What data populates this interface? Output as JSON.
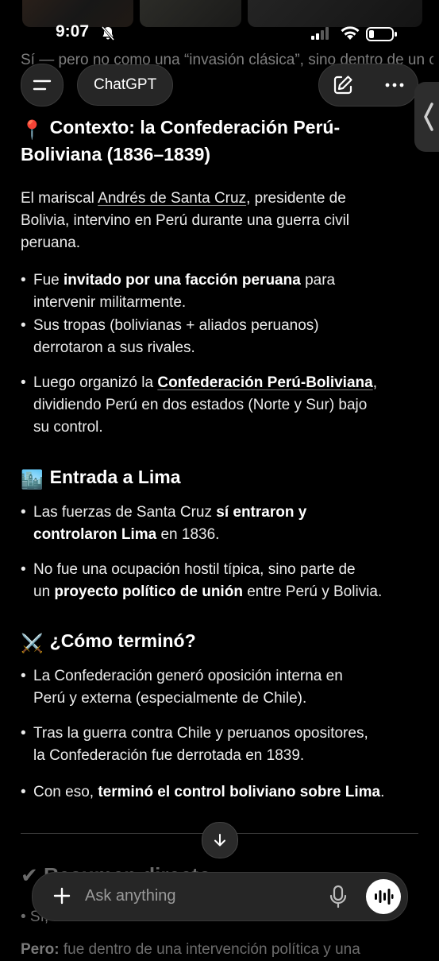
{
  "status": {
    "time": "9:07"
  },
  "ghost_text": "Sí — pero no como una “invasión clásica”, sino dentro de un contexto político particular.",
  "header": {
    "title": "ChatGPT"
  },
  "section1": {
    "emoji": "📍",
    "heading_line1": "Contexto: la Confederación Perú-",
    "heading_line2": "Boliviana (1836–1839)",
    "para": {
      "l1_pre": "El mariscal ",
      "l1_link": "Andrés de Santa Cruz",
      "l1_post": ", presidente de",
      "l2": "Bolivia, intervino en Perú durante una guerra civil",
      "l3": "peruana."
    },
    "bullet1": {
      "pre": "Fue ",
      "bold": "invitado por una facción peruana",
      "post": " para",
      "l2": "intervenir militarmente."
    },
    "bullet2": {
      "l1": "Sus tropas (bolivianas + aliados peruanos)",
      "l2": "derrotaron a sus rivales."
    },
    "bullet3": {
      "pre": "Luego organizó la ",
      "link": "Confederación Perú-Boliviana",
      "post": ",",
      "l2": "dividiendo Perú en dos estados (Norte y Sur) bajo",
      "l3": "su control."
    }
  },
  "section2": {
    "emoji": "🏙️",
    "heading": "Entrada a Lima",
    "bullet1": {
      "pre": "Las fuerzas de Santa Cruz ",
      "bold1": "sí entraron y",
      "bold2": "controlaron Lima",
      "post": " en 1836."
    },
    "bullet2": {
      "l1": "No fue una ocupación hostil típica, sino parte de",
      "pre": "un ",
      "bold": "proyecto político de unión",
      "post": " entre Perú y Bolivia."
    }
  },
  "section3": {
    "emoji": "⚔️",
    "heading": "¿Cómo terminó?",
    "bullet1": {
      "l1": "La Confederación generó oposición interna en",
      "l2": "Perú y externa (especialmente de Chile)."
    },
    "bullet2": {
      "l1": "Tras la guerra contra Chile y peruanos opositores,",
      "l2": "la Confederación fue derrotada en 1839."
    },
    "bullet3": {
      "pre": "Con eso, ",
      "bold": "terminó el control boliviano sobre Lima",
      "post": "."
    }
  },
  "under_composer": {
    "heading": "✔ Resumen directo",
    "line1": "• Sí, ...",
    "line2_bold": "Pero:",
    "line2_rest": " fue dentro de una intervención política y una"
  },
  "composer": {
    "placeholder": "Ask anything"
  },
  "icons": {
    "menu": "menu-icon",
    "compose": "compose-icon",
    "more": "more-icon",
    "side_tab": "chevron-left-icon",
    "scroll": "arrow-down-icon",
    "plus": "plus-icon",
    "mic": "microphone-icon",
    "voice": "voice-mode-icon"
  }
}
